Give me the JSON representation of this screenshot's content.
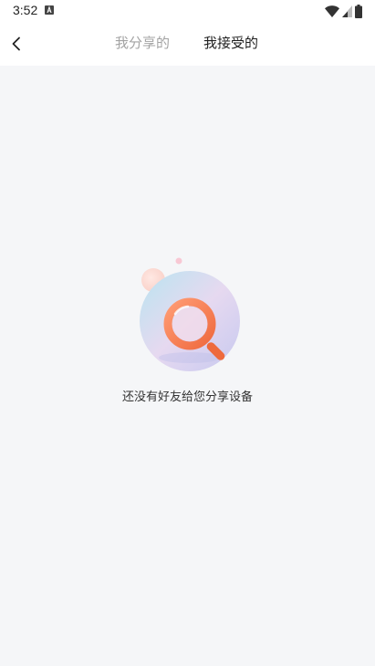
{
  "status_bar": {
    "time": "3:52",
    "icons": [
      "a-notification-icon",
      "wifi-icon",
      "signal-icon",
      "battery-icon"
    ]
  },
  "header": {
    "back_icon": "chevron-left-icon",
    "tabs": [
      {
        "label": "我分享的",
        "active": false
      },
      {
        "label": "我接受的",
        "active": true
      }
    ]
  },
  "empty_state": {
    "illustration": "magnifier-search-icon",
    "message": "还没有好友给您分享设备"
  },
  "colors": {
    "background": "#f5f6f8",
    "header_background": "#ffffff",
    "tab_active": "#1f1f1f",
    "tab_inactive": "#a3a3a3",
    "accent_orange": "#f07a4e"
  }
}
